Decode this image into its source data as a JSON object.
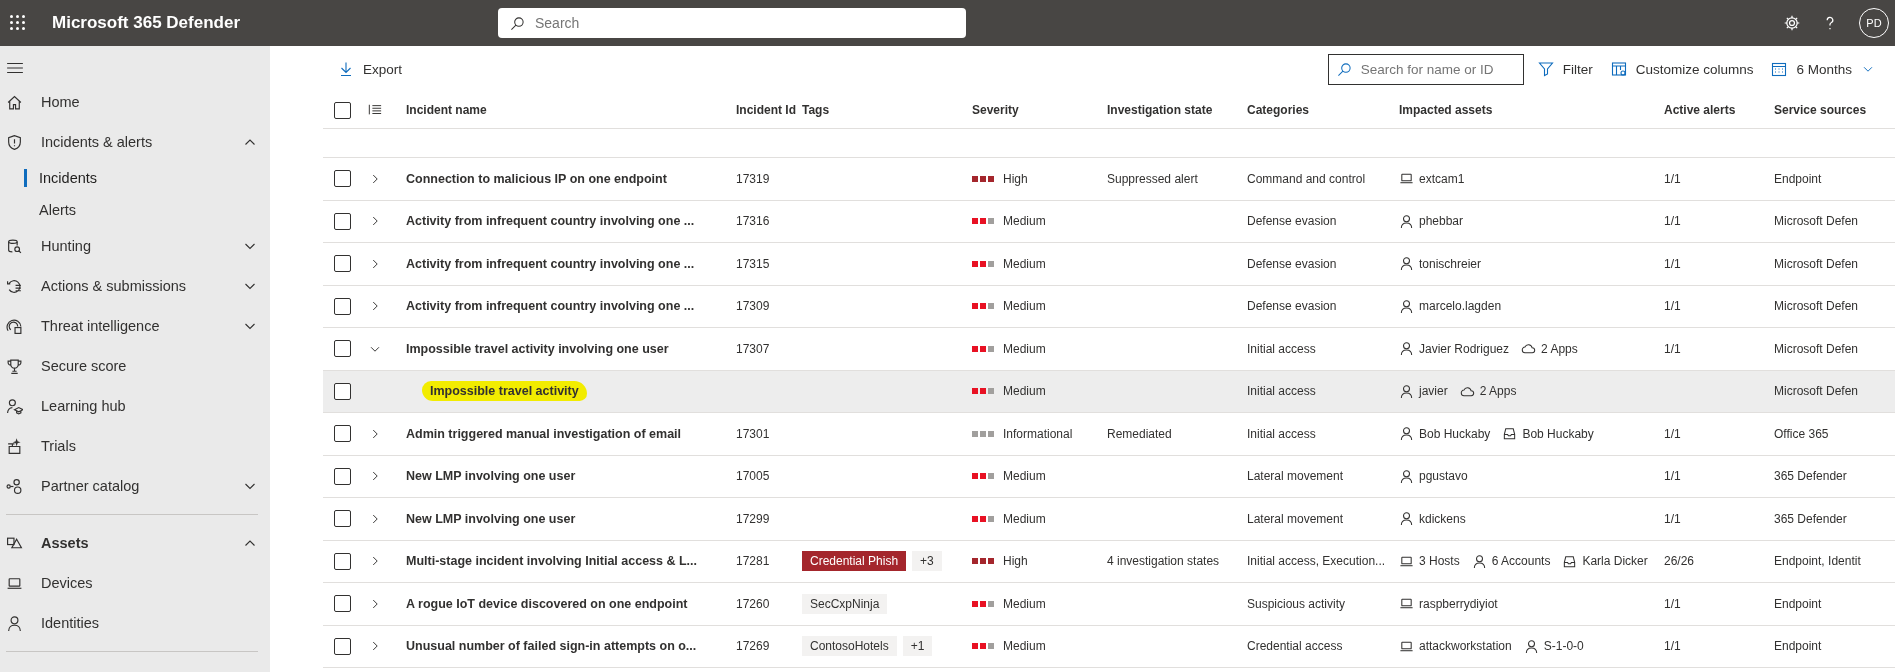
{
  "top_bar": {
    "title": "Microsoft 365 Defender",
    "search": {
      "placeholder": "Search"
    },
    "avatar": "PD"
  },
  "sidebar": {
    "items": [
      {
        "label": "Home",
        "selected": false
      },
      {
        "label": "Incidents & alerts",
        "selected": false,
        "expanded": true,
        "children": [
          {
            "label": "Incidents",
            "selected": true
          },
          {
            "label": "Alerts",
            "selected": false
          }
        ]
      },
      {
        "label": "Hunting",
        "selected": false,
        "expanded": false
      },
      {
        "label": "Actions & submissions",
        "selected": false,
        "expanded": false
      },
      {
        "label": "Threat intelligence",
        "selected": false,
        "expanded": false
      },
      {
        "label": "Secure score",
        "selected": false
      },
      {
        "label": "Learning hub",
        "selected": false
      },
      {
        "label": "Trials",
        "selected": false
      },
      {
        "label": "Partner catalog",
        "selected": false,
        "expanded": false
      }
    ],
    "sections": [
      {
        "label": "Assets",
        "expanded": true,
        "items": [
          {
            "label": "Devices",
            "selected": false
          },
          {
            "label": "Identities",
            "selected": false
          }
        ]
      }
    ]
  },
  "toolbar": {
    "export": "Export",
    "search": {
      "placeholder": "Search for name or ID"
    },
    "filter": "Filter",
    "customize": "Customize columns",
    "period": "6 Months"
  },
  "table": {
    "all_checked": false,
    "columns": [
      "Incident name",
      "Incident Id",
      "Tags",
      "Severity",
      "Investigation state",
      "Categories",
      "Impacted assets",
      "Active alerts",
      "Service sources"
    ],
    "rows": [
      {
        "name": "Connection to malicious IP on one endpoint",
        "id": "17319",
        "severity": {
          "label": "High",
          "kind": "high"
        },
        "investigation_state": "Suppressed alert",
        "categories": "Command and control",
        "assets": [
          {
            "kind": "device",
            "label": "extcam1"
          }
        ],
        "active_alerts": "1/1",
        "service_sources": "Endpoint",
        "checked": false,
        "expanded": false,
        "selected": false
      },
      {
        "name": "Activity from infrequent country involving one ...",
        "id": "17316",
        "severity": {
          "label": "Medium",
          "kind": "medium"
        },
        "categories": "Defense evasion",
        "assets": [
          {
            "kind": "user",
            "label": "phebbar"
          }
        ],
        "active_alerts": "1/1",
        "service_sources": "Microsoft Defen",
        "checked": false,
        "expanded": false,
        "selected": false
      },
      {
        "name": "Activity from infrequent country involving one ...",
        "id": "17315",
        "severity": {
          "label": "Medium",
          "kind": "medium"
        },
        "categories": "Defense evasion",
        "assets": [
          {
            "kind": "user",
            "label": "tonischreier"
          }
        ],
        "active_alerts": "1/1",
        "service_sources": "Microsoft Defen",
        "checked": false,
        "expanded": false,
        "selected": false
      },
      {
        "name": "Activity from infrequent country involving one ...",
        "id": "17309",
        "severity": {
          "label": "Medium",
          "kind": "medium"
        },
        "categories": "Defense evasion",
        "assets": [
          {
            "kind": "user",
            "label": "marcelo.lagden"
          }
        ],
        "active_alerts": "1/1",
        "service_sources": "Microsoft Defen",
        "checked": false,
        "expanded": false,
        "selected": false
      },
      {
        "name": "Impossible travel activity involving one user",
        "id": "17307",
        "severity": {
          "label": "Medium",
          "kind": "medium"
        },
        "categories": "Initial access",
        "assets": [
          {
            "kind": "user",
            "label": "Javier Rodriguez"
          },
          {
            "kind": "cloud",
            "label": "2 Apps"
          }
        ],
        "active_alerts": "1/1",
        "service_sources": "Microsoft Defen",
        "checked": false,
        "expanded": true,
        "selected": false,
        "children": [
          {
            "name": "Impossible travel activity",
            "highlighted": true,
            "severity": {
              "label": "Medium",
              "kind": "medium"
            },
            "categories": "Initial access",
            "assets": [
              {
                "kind": "user",
                "label": "javier"
              },
              {
                "kind": "cloud",
                "label": "2 Apps"
              }
            ],
            "service_sources": "Microsoft Defen",
            "checked": false,
            "selected": true
          }
        ]
      },
      {
        "name": "Admin triggered manual investigation of email",
        "id": "17301",
        "severity": {
          "label": "Informational",
          "kind": "informational"
        },
        "investigation_state": "Remediated",
        "categories": "Initial access",
        "assets": [
          {
            "kind": "user",
            "label": "Bob Huckaby"
          },
          {
            "kind": "mailbox",
            "label": "Bob Huckaby"
          }
        ],
        "active_alerts": "1/1",
        "service_sources": "Office 365",
        "checked": false,
        "expanded": false,
        "selected": false
      },
      {
        "name": "New LMP involving one user",
        "id": "17005",
        "severity": {
          "label": "Medium",
          "kind": "medium"
        },
        "categories": "Lateral movement",
        "assets": [
          {
            "kind": "user",
            "label": "pgustavo"
          }
        ],
        "active_alerts": "1/1",
        "service_sources": "365 Defender",
        "checked": false,
        "expanded": false,
        "selected": false
      },
      {
        "name": "New LMP involving one user",
        "id": "17299",
        "severity": {
          "label": "Medium",
          "kind": "medium"
        },
        "categories": "Lateral movement",
        "assets": [
          {
            "kind": "user",
            "label": "kdickens"
          }
        ],
        "active_alerts": "1/1",
        "service_sources": "365 Defender",
        "checked": false,
        "expanded": false,
        "selected": false
      },
      {
        "name": "Multi-stage incident involving Initial access & L...",
        "id": "17281",
        "tags": [
          {
            "label": "Credential Phish",
            "color": "#a4262c"
          },
          {
            "label": "+3",
            "color": "#f3f2f1"
          }
        ],
        "severity": {
          "label": "High",
          "kind": "high"
        },
        "investigation_state": "4 investigation states",
        "categories": "Initial access, Execution...",
        "assets": [
          {
            "kind": "device",
            "label": "3 Hosts"
          },
          {
            "kind": "user",
            "label": "6 Accounts"
          },
          {
            "kind": "mailbox",
            "label": "Karla Dicker"
          }
        ],
        "active_alerts": "26/26",
        "service_sources": "Endpoint, Identit",
        "checked": false,
        "expanded": false,
        "selected": false
      },
      {
        "name": "A rogue IoT device discovered on one endpoint",
        "id": "17260",
        "tags": [
          {
            "label": "SecCxpNinja",
            "color": "#f3f2f1"
          }
        ],
        "severity": {
          "label": "Medium",
          "kind": "medium"
        },
        "categories": "Suspicious activity",
        "assets": [
          {
            "kind": "device",
            "label": "raspberrydiyiot"
          }
        ],
        "active_alerts": "1/1",
        "service_sources": "Endpoint",
        "checked": false,
        "expanded": false,
        "selected": false
      },
      {
        "name": "Unusual number of failed sign-in attempts on o...",
        "id": "17269",
        "tags": [
          {
            "label": "ContosoHotels",
            "color": "#f3f2f1"
          },
          {
            "label": "+1",
            "color": "#f3f2f1"
          }
        ],
        "severity": {
          "label": "Medium",
          "kind": "medium"
        },
        "categories": "Credential access",
        "assets": [
          {
            "kind": "device",
            "label": "attackworkstation"
          },
          {
            "kind": "user",
            "label": "S-1-0-0"
          }
        ],
        "active_alerts": "1/1",
        "service_sources": "Endpoint",
        "checked": false,
        "expanded": false,
        "selected": false
      }
    ]
  }
}
